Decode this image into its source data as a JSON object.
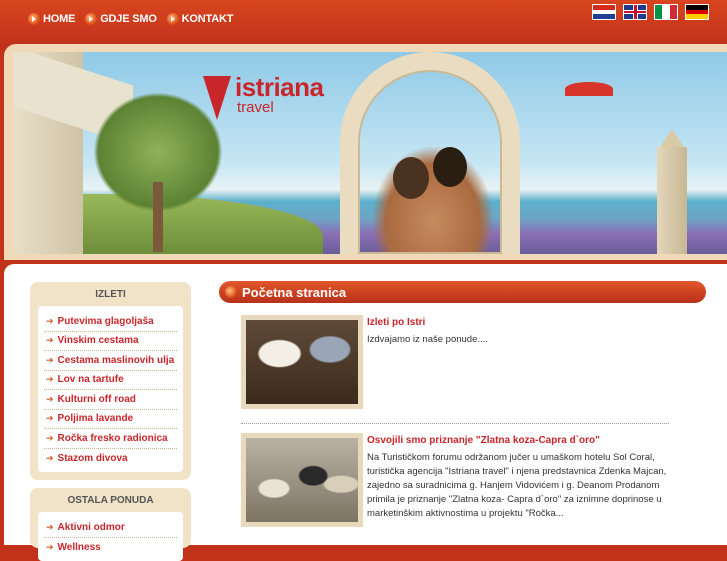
{
  "nav": {
    "items": [
      {
        "label": "HOME"
      },
      {
        "label": "GDJE SMO"
      },
      {
        "label": "KONTAKT"
      }
    ]
  },
  "flags": [
    {
      "icon": "croatia-flag-icon"
    },
    {
      "icon": "uk-flag-icon"
    },
    {
      "icon": "italy-flag-icon"
    },
    {
      "icon": "germany-flag-icon"
    }
  ],
  "banner": {
    "logo_name": "istriana",
    "logo_sub": "travel"
  },
  "sidebar": {
    "izleti": {
      "title": "IZLETI",
      "items": [
        {
          "label": "Putevima glagoljaša"
        },
        {
          "label": "Vinskim cestama"
        },
        {
          "label": "Cestama maslinovih ulja"
        },
        {
          "label": "Lov na tartufe"
        },
        {
          "label": "Kulturni off road"
        },
        {
          "label": "Poljima lavande"
        },
        {
          "label": "Ročka fresko radionica"
        },
        {
          "label": "Stazom divova"
        }
      ]
    },
    "ostala": {
      "title": "OSTALA PONUDA",
      "items": [
        {
          "label": "Aktivni odmor"
        },
        {
          "label": "Wellness"
        }
      ]
    }
  },
  "main": {
    "section_title": "Početna stranica",
    "articles": [
      {
        "title": "Izleti po Istri",
        "text": "Izdvajamo iz naše ponude...."
      },
      {
        "title": "Osvojili smo priznanje \"Zlatna koza-Capra d`oro\"",
        "text": "Na Turističkom forumu održanom jučer u umaškom hotelu Sol Coral, turistička agencija \"Istriana travel\" i njena predstavnica Zdenka Majcan, zajedno sa suradnicima g. Hanjem Vidovićem i g. Deanom Prodanom primila je priznanje \"Zlatna koza- Capra d`oro\"  za iznimne doprinose u marketinškim aktivnostima u projektu \"Ročka..."
      }
    ]
  },
  "colors": {
    "brand_red": "#c8262b",
    "topbar": "#c2321a",
    "sidebar_bg": "#f1e3c8"
  }
}
